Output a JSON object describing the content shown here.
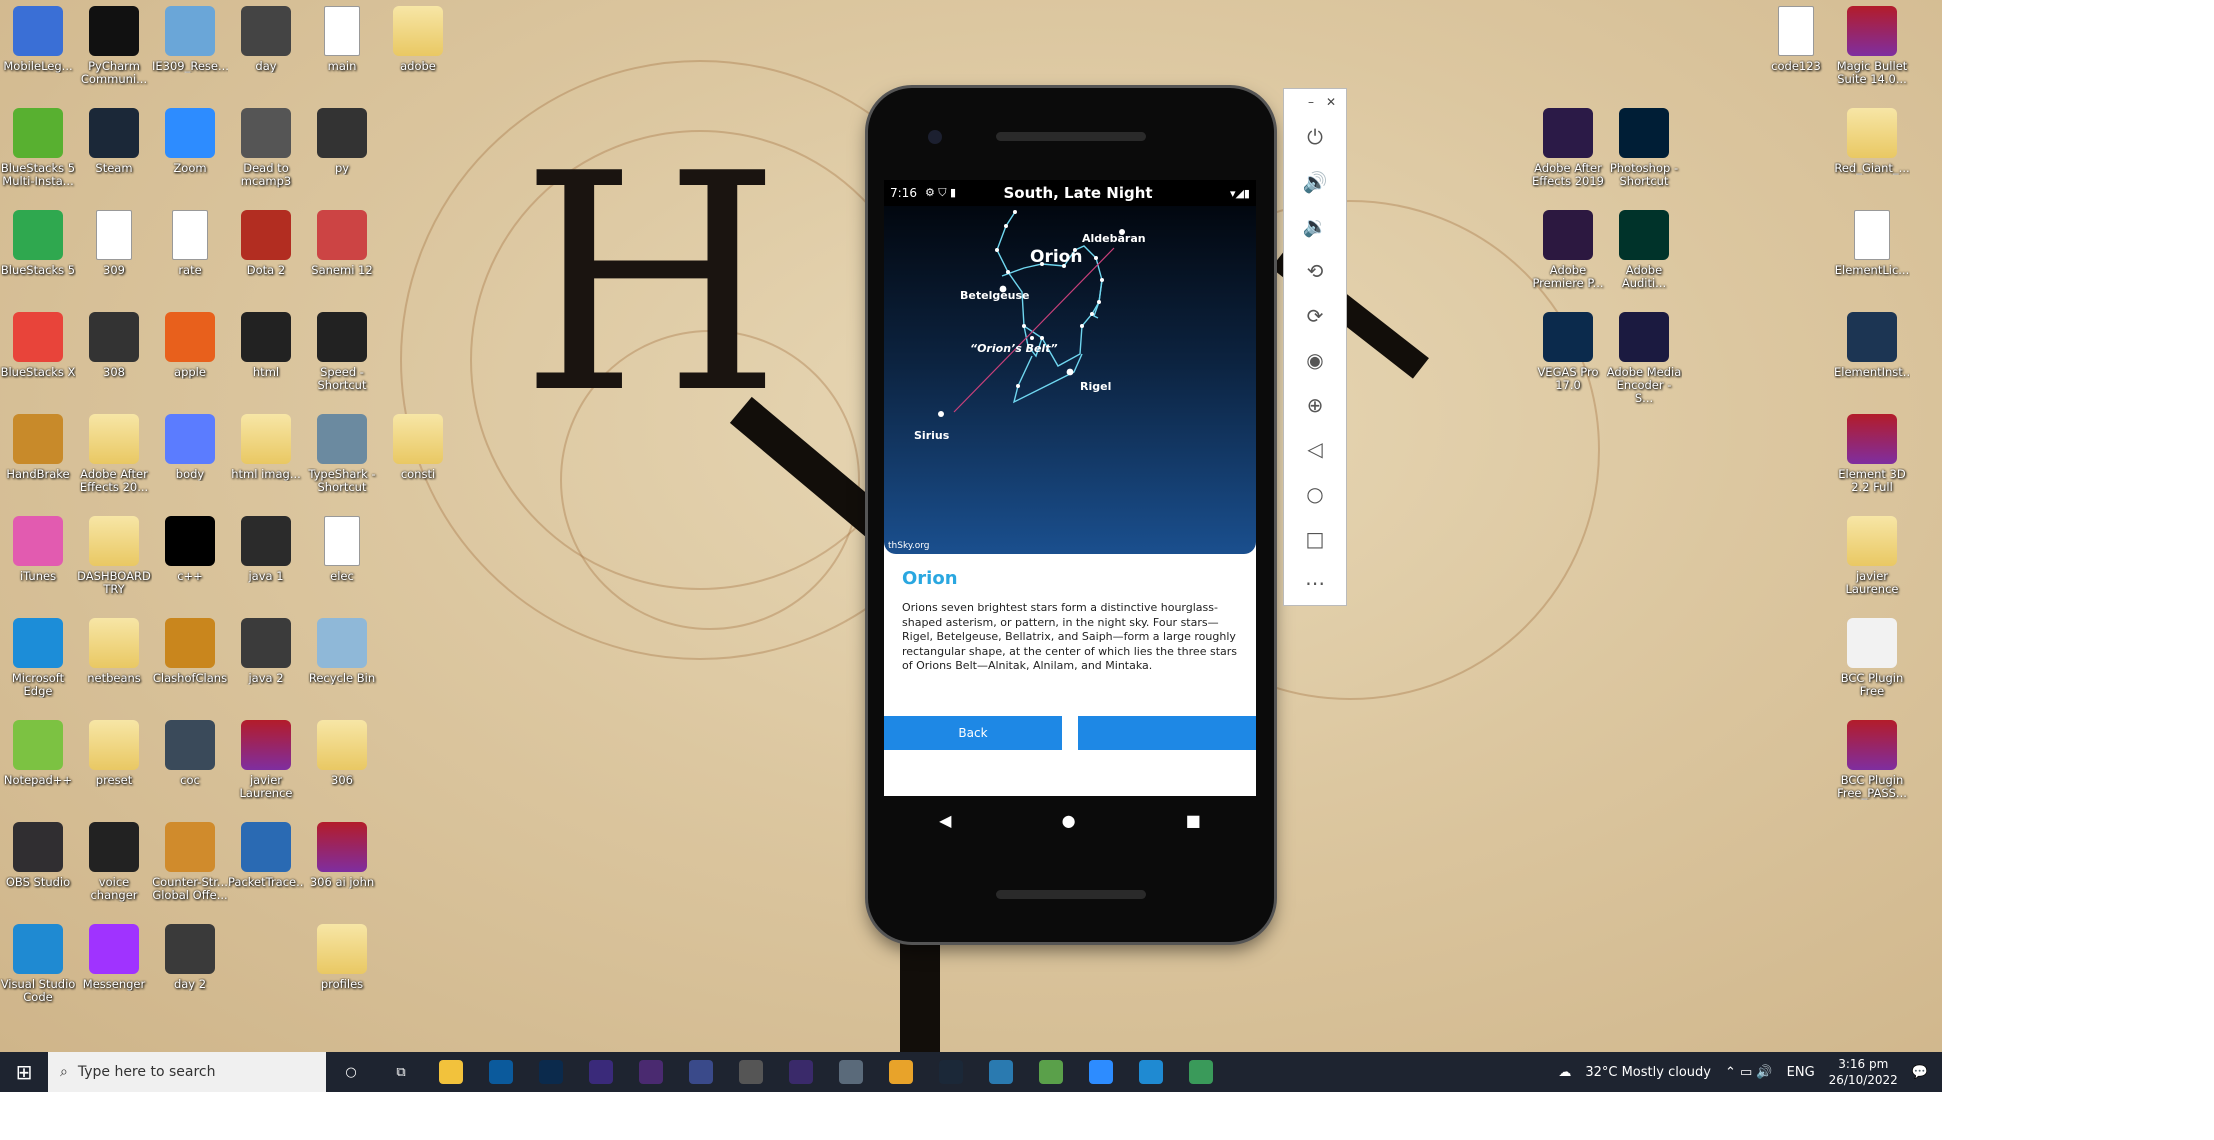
{
  "desktop": {
    "col1": [
      {
        "label": "MobileLeg...",
        "icon": "mobile-legends-icon",
        "color": "#3a6fd6"
      },
      {
        "label": "BlueStacks 5 Multi-Insta...",
        "icon": "bluestacks-multi-icon",
        "color": "#58b030"
      },
      {
        "label": "BlueStacks 5",
        "icon": "bluestacks-icon",
        "color": "#2fa84f"
      },
      {
        "label": "BlueStacks X",
        "icon": "bluestacks-x-icon",
        "color": "#e8443a"
      },
      {
        "label": "HandBrake",
        "icon": "handbrake-icon",
        "color": "#c88a2a"
      },
      {
        "label": "iTunes",
        "icon": "itunes-icon",
        "color": "#e25bb0"
      },
      {
        "label": "Microsoft Edge",
        "icon": "edge-icon",
        "color": "#1c8dd8"
      },
      {
        "label": "Notepad++",
        "icon": "notepad-plus-icon",
        "color": "#7cc242"
      },
      {
        "label": "OBS Studio",
        "icon": "obs-icon",
        "color": "#302e31"
      },
      {
        "label": "Visual Studio Code",
        "icon": "vscode-icon",
        "color": "#1f8ad2"
      }
    ],
    "col2": [
      {
        "label": "PyCharm Communi...",
        "icon": "pycharm-icon",
        "color": "#111"
      },
      {
        "label": "Steam",
        "icon": "steam-icon",
        "color": "#1b2838"
      },
      {
        "label": "309",
        "icon": "document-icon",
        "color": "doc"
      },
      {
        "label": "308",
        "icon": "archive-icon",
        "color": "#333"
      },
      {
        "label": "Adobe After Effects 20...",
        "icon": "folder-icon",
        "color": "fold"
      },
      {
        "label": "DASHBOARD TRY",
        "icon": "folder-icon",
        "color": "fold"
      },
      {
        "label": "netbeans",
        "icon": "folder-icon",
        "color": "fold"
      },
      {
        "label": "preset",
        "icon": "folder-icon",
        "color": "fold"
      },
      {
        "label": "voice changer",
        "icon": "voice-changer-icon",
        "color": "#222"
      },
      {
        "label": "Messenger",
        "icon": "messenger-icon",
        "color": "#a033ff"
      }
    ],
    "col3": [
      {
        "label": "IE309_Rese...",
        "icon": "notepad-icon",
        "color": "#6aa6d8"
      },
      {
        "label": "Zoom",
        "icon": "zoom-icon",
        "color": "#2d8cff"
      },
      {
        "label": "rate",
        "icon": "document-icon",
        "color": "doc"
      },
      {
        "label": "apple",
        "icon": "apple-icon",
        "color": "#e8601c"
      },
      {
        "label": "body",
        "icon": "body-icon",
        "color": "#5b7cff"
      },
      {
        "label": "c++",
        "icon": "cpp-icon",
        "color": "#000"
      },
      {
        "label": "ClashofClans",
        "icon": "clash-icon",
        "color": "#c9861d"
      },
      {
        "label": "coc",
        "icon": "image-icon",
        "color": "#3a4a5a"
      },
      {
        "label": "Counter-Str... Global Offe...",
        "icon": "csgo-icon",
        "color": "#d08b2c"
      },
      {
        "label": "day 2",
        "icon": "image-icon",
        "color": "#3a3a3a"
      }
    ],
    "col4": [
      {
        "label": "day",
        "icon": "image-icon",
        "color": "#444"
      },
      {
        "label": "Dead to mcamp3",
        "icon": "media-icon",
        "color": "#555"
      },
      {
        "label": "Dota 2",
        "icon": "dota-icon",
        "color": "#b22d21"
      },
      {
        "label": "html",
        "icon": "image-icon",
        "color": "#222"
      },
      {
        "label": "html imag...",
        "icon": "folder-icon",
        "color": "fold"
      },
      {
        "label": "java 1",
        "icon": "image-icon",
        "color": "#2b2b2b"
      },
      {
        "label": "java 2",
        "icon": "image-icon",
        "color": "#3b3b3b"
      },
      {
        "label": "javier Laurence",
        "icon": "winrar-icon",
        "color": "rar"
      },
      {
        "label": "PacketTrace...",
        "icon": "packet-tracer-icon",
        "color": "#2a6ab3"
      }
    ],
    "col5": [
      {
        "label": "main",
        "icon": "document-icon",
        "color": "doc"
      },
      {
        "label": "py",
        "icon": "image-icon",
        "color": "#333"
      },
      {
        "label": "Sanemi 12",
        "icon": "image-icon",
        "color": "#c44"
      },
      {
        "label": "Speed - Shortcut",
        "icon": "speed-icon",
        "color": "#222"
      },
      {
        "label": "TypeShark - Shortcut",
        "icon": "typeshark-icon",
        "color": "#6b8aa0"
      },
      {
        "label": "elec",
        "icon": "document-icon",
        "color": "doc"
      },
      {
        "label": "Recycle Bin",
        "icon": "recycle-bin-icon",
        "color": "#8fb8d8"
      },
      {
        "label": "306",
        "icon": "folder-icon",
        "color": "fold"
      },
      {
        "label": "306 ai john",
        "icon": "winrar-icon",
        "color": "rar"
      },
      {
        "label": "profiles",
        "icon": "folder-icon",
        "color": "fold"
      }
    ],
    "col6": [
      {
        "label": "adobe",
        "icon": "folder-icon",
        "color": "fold"
      },
      {
        "label": "consti",
        "icon": "folder-icon",
        "color": "fold"
      }
    ],
    "colA": [
      {
        "label": "Adobe After Effects 2019",
        "icon": "after-effects-icon",
        "color": "#2b1a47"
      },
      {
        "label": "Adobe Premiere P...",
        "icon": "premiere-icon",
        "color": "#2c1840"
      },
      {
        "label": "VEGAS Pro 17.0",
        "icon": "vegas-icon",
        "color": "#0b2a4c"
      }
    ],
    "colB": [
      {
        "label": "Photoshop - Shortcut",
        "icon": "photoshop-icon",
        "color": "#001e36"
      },
      {
        "label": "Adobe Auditi...",
        "icon": "audition-icon",
        "color": "#00332a"
      },
      {
        "label": "Adobe Media Encoder - S...",
        "icon": "media-encoder-icon",
        "color": "#1b1a40"
      }
    ],
    "colC": [
      {
        "label": "code123",
        "icon": "document-icon",
        "color": "doc"
      }
    ],
    "colD": [
      {
        "label": "Magic Bullet Suite 14.0...",
        "icon": "winrar-icon",
        "color": "rar"
      },
      {
        "label": "Red_Giant_...",
        "icon": "folder-icon",
        "color": "fold"
      },
      {
        "label": "ElementLic...",
        "icon": "document-icon",
        "color": "doc"
      },
      {
        "label": "ElementInst...",
        "icon": "element-icon",
        "color": "#1c3553"
      },
      {
        "label": "Element 3D 2.2 Full",
        "icon": "winrar-icon",
        "color": "rar"
      },
      {
        "label": "javier Laurence",
        "icon": "folder-icon",
        "color": "fold"
      },
      {
        "label": "BCC Plugin Free",
        "icon": "bcc-icon",
        "color": "#f2f2f2"
      },
      {
        "label": "BCC Plugin Free_PASS...",
        "icon": "winrar-icon",
        "color": "rar"
      }
    ]
  },
  "phone": {
    "time": "7:16",
    "title": "South, Late Night",
    "stars": {
      "aldebaran": "Aldebaran",
      "orion": "Orion",
      "betelgeuse": "Betelgeuse",
      "belt": "“Orion’s Belt”",
      "rigel": "Rigel",
      "sirius": "Sirius"
    },
    "credit": "thSky.org",
    "heading": "Orion",
    "description": "Orions seven brightest stars form a distinctive hourglass-shaped asterism, or pattern, in the night sky. Four stars—Rigel, Betelgeuse, Bellatrix, and Saiph—form a large roughly rectangular shape, at the center of which lies the three stars of Orions Belt—Alnitak, Alnilam, and Mintaka.",
    "back_label": "Back",
    "next_label": ""
  },
  "emulator_panel": {
    "minimize": "–",
    "close": "✕"
  },
  "taskbar": {
    "search_placeholder": "Type here to search",
    "weather": "32°C  Mostly cloudy",
    "lang": "ENG",
    "time": "3:16 pm",
    "date": "26/10/2022"
  }
}
